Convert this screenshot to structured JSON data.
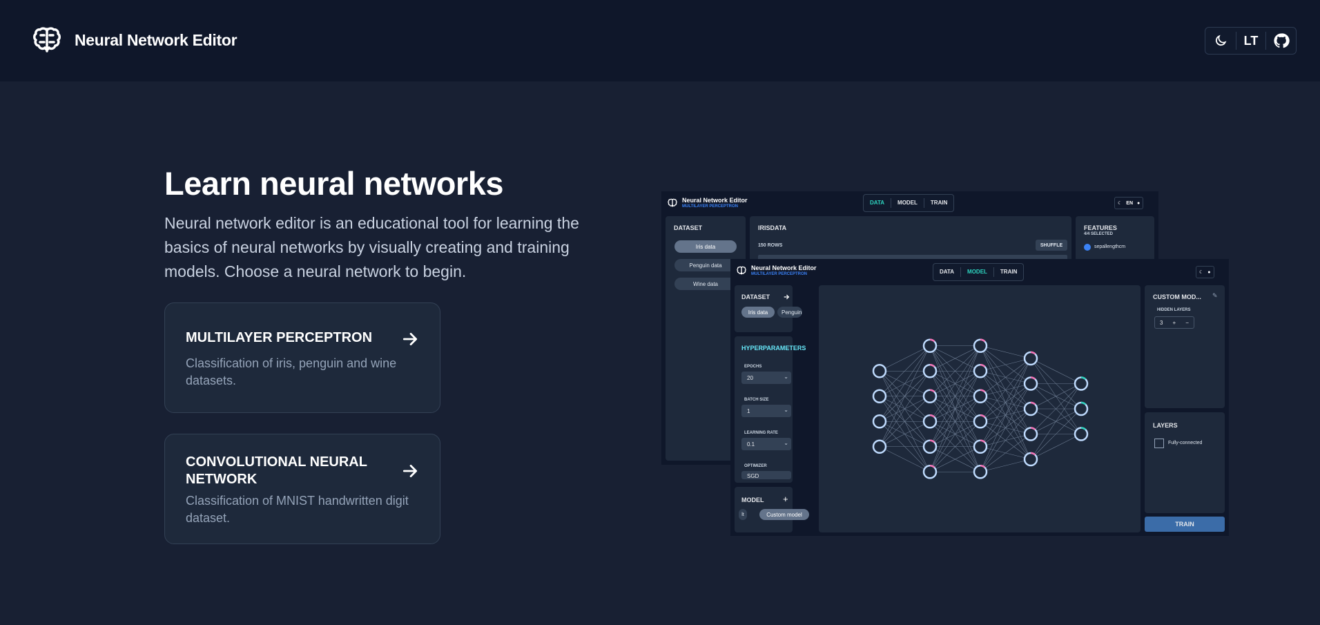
{
  "header": {
    "title": "Neural Network Editor",
    "lang": "LT",
    "icons": [
      "brain-icon",
      "moon-icon",
      "github-icon"
    ]
  },
  "hero": {
    "title": "Learn neural networks",
    "description": "Neural network editor is an educational tool for learning the basics of neural networks by visually creating and training models. Choose a neural network to begin."
  },
  "cards": [
    {
      "title": "MULTILAYER PERCEPTRON",
      "desc": "Classification of iris, penguin and wine datasets."
    },
    {
      "title": "CONVOLUTIONAL NEURAL NETWORK",
      "desc": "Classification of MNIST handwritten digit dataset."
    }
  ],
  "mock_back": {
    "brand_title": "Neural Network Editor",
    "brand_sub": "MULTILAYER PERCEPTRON",
    "tabs": [
      "DATA",
      "MODEL",
      "TRAIN"
    ],
    "active_tab": "DATA",
    "lang": "EN",
    "dataset_title": "DATASET",
    "datasets": [
      "Iris data",
      "Penguin data",
      "Wine data"
    ],
    "table_title": "IRISDATA",
    "rows": "150 ROWS",
    "shuffle": "SHUFFLE",
    "features_title": "FEATURES",
    "features_sub": "4/4 SELECTED",
    "feature_first": "sepallengthcm"
  },
  "mock_front": {
    "brand_title": "Neural Network Editor",
    "brand_sub": "MULTILAYER PERCEPTRON",
    "tabs": [
      "DATA",
      "MODEL",
      "TRAIN"
    ],
    "active_tab": "MODEL",
    "dataset_title": "DATASET",
    "datasets": [
      "Iris data",
      "Penguin"
    ],
    "hyper_title": "HYPERPARAMETERS",
    "epochs_label": "EPOCHS",
    "epochs": "20",
    "batch_label": "BATCH SIZE",
    "batch": "1",
    "lr_label": "LEARNING RATE",
    "lr": "0.1",
    "optimizer_label": "OPTIMIZER",
    "optimizer": "SGD",
    "model_title": "MODEL",
    "models": [
      "lt",
      "Custom model"
    ],
    "custom_title": "CUSTOM MOD...",
    "hidden_label": "HIDDEN LAYERS",
    "hidden_count": "3",
    "layers_title": "LAYERS",
    "layer_type": "Fully-connected",
    "train_button": "TRAIN",
    "network_layers": [
      4,
      6,
      6,
      5,
      3
    ]
  }
}
